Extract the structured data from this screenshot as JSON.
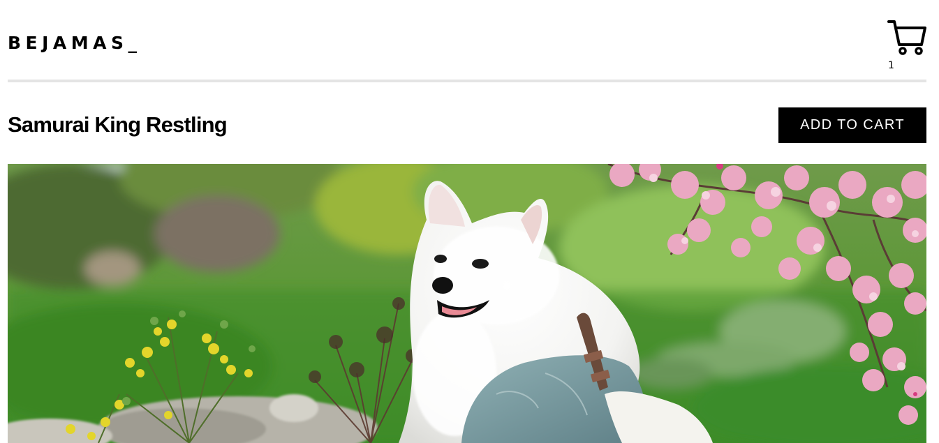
{
  "header": {
    "logo": "BEJAMAS_",
    "cart_count": "1",
    "cart_icon": "cart-icon"
  },
  "product": {
    "title": "Samurai King Restling",
    "add_to_cart_label": "ADD TO CART"
  },
  "hero_image": {
    "subject": "samoyed-dog-in-hanbok-with-cherry-blossoms",
    "colors": {
      "grass": "#3f8f2a",
      "blossom": "#e9a7c1",
      "fur": "#f7f7f5",
      "robe": "#7e9ea4"
    }
  }
}
